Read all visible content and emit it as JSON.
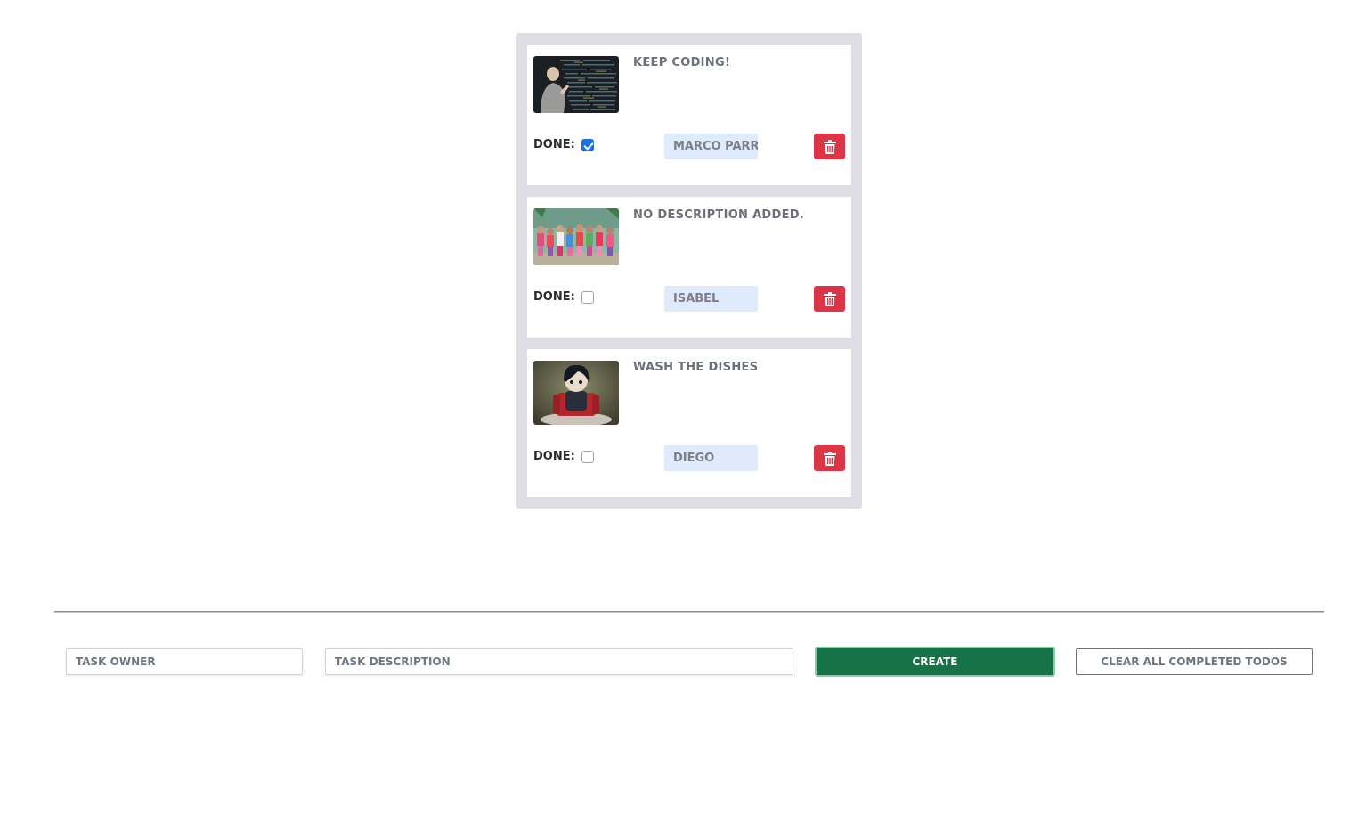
{
  "todos": [
    {
      "description": "Keep coding!",
      "owner": "Marco Parr",
      "done": true,
      "done_label": "Done:",
      "image": "person-at-code-wall-photo"
    },
    {
      "description": "No description added.",
      "owner": "Isabel",
      "done": false,
      "done_label": "Done:",
      "image": "children-group-photo"
    },
    {
      "description": "Wash the dishes",
      "owner": "Diego",
      "done": false,
      "done_label": "Done:",
      "image": "anime-figure-on-chair-photo"
    }
  ],
  "form": {
    "owner_placeholder": "Task owner",
    "description_placeholder": "Task description",
    "create_label": "Create",
    "clear_label": "Clear all completed todos"
  },
  "icons": {
    "delete": "trash-icon",
    "checked": "checkmark-icon"
  },
  "colors": {
    "delete_button": "#dc3545",
    "create_button": "#157347",
    "checkbox_checked": "#1a6fe8",
    "owner_badge_bg": "#dfeafc",
    "panel_bg": "#dddde3"
  }
}
